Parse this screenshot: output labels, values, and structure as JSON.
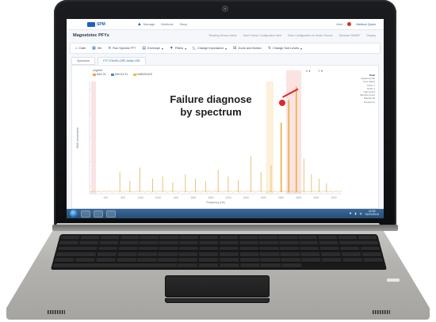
{
  "app": {
    "logo_text": "SPM",
    "nav": [
      "Manage",
      "Methods",
      "Diary"
    ],
    "header_right": "Alert",
    "user_name": "Method Quick"
  },
  "crumbs": {
    "title": "Magnetotec PFYs",
    "meta": [
      "Reading Sensor Alerts",
      "Save Check Configuration Alert",
      "Save Configuration to Vector Source",
      "Advance SMART",
      "Display"
    ]
  },
  "toolbar": {
    "items": [
      {
        "icon": "home-icon",
        "label": "Date"
      },
      {
        "icon": "calendar-icon",
        "label": "0th"
      },
      {
        "icon": "chart-icon",
        "label": "Run Spectra FFT"
      },
      {
        "icon": "filter-icon",
        "label": "Envelope"
      },
      {
        "icon": "filter-icon",
        "label": "Filters"
      },
      {
        "icon": "ruler-icon",
        "label": "Change Impedance"
      },
      {
        "icon": "zoom-icon",
        "label": "Zoom and Motion"
      },
      {
        "icon": "sync-icon",
        "label": "Change Sub Levels"
      }
    ]
  },
  "tabs": [
    "Spectrum",
    "FFT ENVELOPE ANALYSE"
  ],
  "chart": {
    "legend_title": "Legend",
    "legend": [
      {
        "name": "MAX OL",
        "color": "#f0a43a"
      },
      {
        "name": "WHOLE EL",
        "color": "#3a8fd4"
      },
      {
        "name": "HARMONICS",
        "color": "#e4c34a"
      }
    ],
    "controls": [
      "X ▾",
      "≡ ▾"
    ],
    "side_heading": "Peak",
    "side_items": [
      "Highest peak",
      "Next tallest",
      "Order 1",
      "Order 2",
      "Harmonics",
      "Bearing tones",
      "Sidebands",
      "Frequency"
    ],
    "callout": [
      "Failure diagnose",
      "by spectrum"
    ]
  },
  "chart_data": {
    "type": "line",
    "title": "",
    "xlabel": "Frequency (Hz)",
    "ylabel": "RMS acceleration",
    "x_ticks": [
      "400",
      "600",
      "1000",
      "1200",
      "1400",
      "1600",
      "1800",
      "2000",
      "2200",
      "2400",
      "2600",
      "2800",
      "3000",
      "3200"
    ],
    "peaks": [
      {
        "x": 0.12,
        "h": 0.18
      },
      {
        "x": 0.16,
        "h": 0.1
      },
      {
        "x": 0.2,
        "h": 0.22
      },
      {
        "x": 0.25,
        "h": 0.12
      },
      {
        "x": 0.29,
        "h": 0.14
      },
      {
        "x": 0.33,
        "h": 0.09
      },
      {
        "x": 0.38,
        "h": 0.16
      },
      {
        "x": 0.42,
        "h": 0.12
      },
      {
        "x": 0.46,
        "h": 0.1
      },
      {
        "x": 0.51,
        "h": 0.2
      },
      {
        "x": 0.55,
        "h": 0.14
      },
      {
        "x": 0.59,
        "h": 0.11
      },
      {
        "x": 0.64,
        "h": 0.32
      },
      {
        "x": 0.68,
        "h": 0.18
      },
      {
        "x": 0.72,
        "h": 0.24
      },
      {
        "x": 0.76,
        "h": 0.62
      },
      {
        "x": 0.79,
        "h": 0.82
      },
      {
        "x": 0.82,
        "h": 0.94
      },
      {
        "x": 0.85,
        "h": 0.3
      },
      {
        "x": 0.88,
        "h": 0.16
      },
      {
        "x": 0.91,
        "h": 0.12
      },
      {
        "x": 0.94,
        "h": 0.08
      }
    ]
  },
  "taskbar": {
    "clock_time": "12:00",
    "clock_date": "01/01/2014"
  }
}
